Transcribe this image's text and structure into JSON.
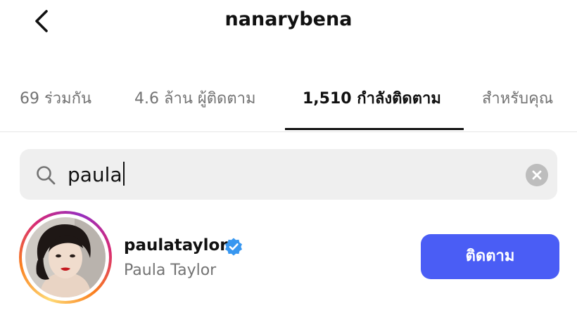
{
  "header": {
    "back_icon": "chevron-left-icon",
    "username": "nanarybena"
  },
  "tabs": [
    {
      "label": "69 ร่วมกัน",
      "active": false
    },
    {
      "label": "4.6 ล้าน ผู้ติดตาม",
      "active": false
    },
    {
      "label": "1,510 กำลังติดตาม",
      "active": true
    },
    {
      "label": "สำหรับคุณ",
      "active": false
    }
  ],
  "search": {
    "icon": "search-icon",
    "value": "paula",
    "clear_icon": "clear-icon"
  },
  "results": [
    {
      "handle": "paulataylor",
      "verified": true,
      "full_name": "Paula Taylor",
      "follow_label": "ติดตาม",
      "has_story_ring": true
    }
  ],
  "colors": {
    "accent": "#4a5df5",
    "verified": "#3897f0",
    "muted_text": "#737373",
    "search_bg": "#efefef"
  }
}
